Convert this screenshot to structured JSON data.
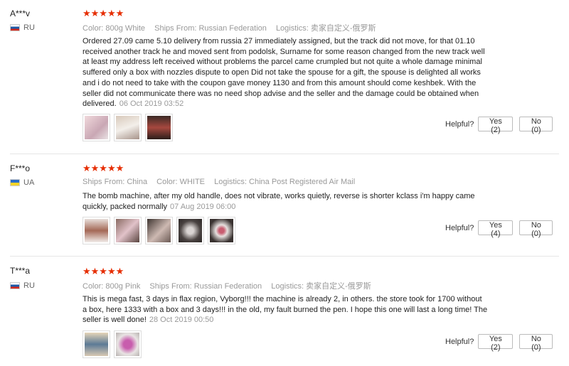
{
  "reviews": [
    {
      "user": "A***v",
      "country": "RU",
      "stars_icon": "★★★★★",
      "meta": [
        {
          "label": "Color:",
          "value": "800g White"
        },
        {
          "label": "Ships From:",
          "value": "Russian Federation"
        },
        {
          "label": "Logistics:",
          "value": "卖家自定义-俄罗斯"
        }
      ],
      "text": "Ordered 27.09 came 5.10 delivery from russia 27 immediately assigned, but the track did not move, for that 01.10 received another track he and moved sent from podolsk, Surname for some reason changed from the new track well at least my address left received without problems the parcel came crumpled but not quite a whole damage minimal suffered only a box with nozzles dispute to open Did not take the spouse for a gift, the spouse is delighted all works and i do not need to take with the coupon gave money 1130 and from this amount should come keshbek. With the seller did not communicate there was no need shop advise and the seller and the damage could be obtained when delivered.",
      "date": "06 Oct 2019 03:52",
      "helpful_label": "Helpful?",
      "yes_label": "Yes (2)",
      "no_label": "No (0)"
    },
    {
      "user": "F***o",
      "country": "UA",
      "stars_icon": "★★★★★",
      "meta": [
        {
          "label": "Ships From:",
          "value": "China"
        },
        {
          "label": "Color:",
          "value": "WHITE"
        },
        {
          "label": "Logistics:",
          "value": "China Post Registered Air Mail"
        }
      ],
      "text": "The bomb machine, after my old handle, does not vibrate, works quietly, reverse is shorter kclass i'm happy came quickly, packed normally",
      "date": "07 Aug 2019 06:00",
      "helpful_label": "Helpful?",
      "yes_label": "Yes (4)",
      "no_label": "No (0)"
    },
    {
      "user": "T***a",
      "country": "RU",
      "stars_icon": "★★★★★",
      "meta": [
        {
          "label": "Color:",
          "value": "800g Pink"
        },
        {
          "label": "Ships From:",
          "value": "Russian Federation"
        },
        {
          "label": "Logistics:",
          "value": "卖家自定义-俄罗斯"
        }
      ],
      "text": "This is mega fast, 3 days in flax region, Vyborg!!! the machine is already 2, in others. the store took for 1700 without a box, here 1333 with a box and 3 days!!! in the old, my fault burned the pen. I hope this one will last a long time! The seller is well done!",
      "date": "28 Oct 2019 00:50",
      "helpful_label": "Helpful?",
      "yes_label": "Yes (2)",
      "no_label": "No (0)"
    }
  ],
  "colors": {
    "star": "#e62e04",
    "meta": "#999999",
    "divider": "#e6e6e6"
  }
}
